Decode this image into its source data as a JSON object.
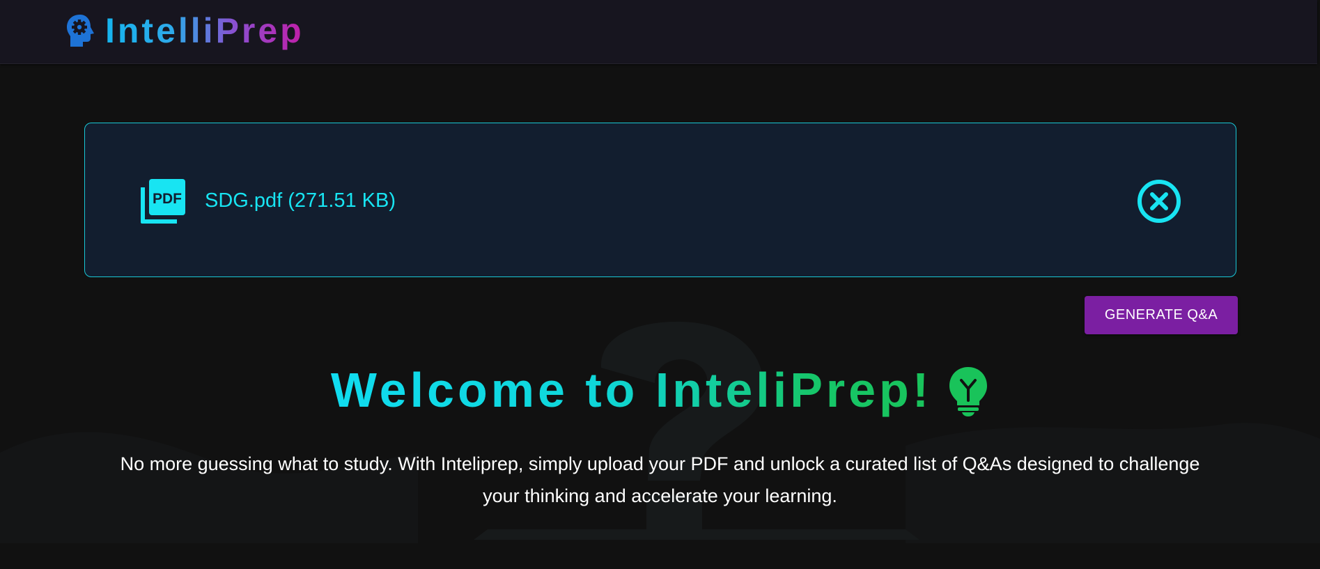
{
  "header": {
    "brand_name": "IntelliPrep",
    "brand_icon": "head-gear-icon"
  },
  "upload": {
    "file_name": "SDG.pdf (271.51 KB)",
    "file_icon": "pdf-stack-icon",
    "remove_icon": "close-circle-icon"
  },
  "actions": {
    "generate_label": "GENERATE Q&A"
  },
  "welcome": {
    "title": "Welcome to InteliPrep!",
    "title_icon": "lightbulb-icon",
    "description": "No more guessing what to study. With Inteliprep, simply upload your PDF and unlock a curated list of Q&As designed to challenge your thinking and accelerate your learning."
  },
  "colors": {
    "background": "#111111",
    "header_bg": "#17151f",
    "card_bg": "#121e2f",
    "accent_cyan": "#18e4f2",
    "button_purple": "#7b1fa2",
    "title_green": "#16c66a"
  }
}
